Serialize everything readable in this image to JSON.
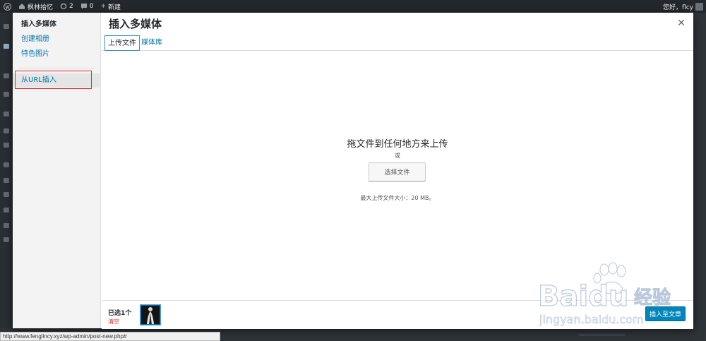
{
  "adminbar": {
    "site_name": "枫林拾忆",
    "updates_count": "2",
    "comments_count": "0",
    "new_label": "新建",
    "greeting": "您好，flcy"
  },
  "modal": {
    "title": "插入多媒体",
    "menu": [
      {
        "label": "插入多媒体",
        "active": true
      },
      {
        "label": "创建相册"
      },
      {
        "label": "特色图片"
      },
      {
        "label": "从URL插入"
      }
    ],
    "tabs": [
      {
        "label": "上传文件",
        "active": true
      },
      {
        "label": "媒体库"
      }
    ],
    "upload": {
      "instructions": "拖文件到任何地方来上传",
      "or": "或",
      "select_button": "选择文件",
      "max_size": "最大上传文件大小：20 MB。"
    },
    "toolbar": {
      "selected_count": "已选1个",
      "clear": "清空",
      "insert_button": "插入至文章"
    }
  },
  "status_url": "http://www.fenglincy.xyz/wp-admin/post-new.php#",
  "watermark": {
    "brand": "Baidu",
    "cn": "经验",
    "url": "jingyan.baidu.com"
  },
  "colors": {
    "accent": "#0073aa",
    "button_primary": "#0085ba",
    "highlight_box": "#e0252b",
    "clear_link": "#dc3232"
  }
}
